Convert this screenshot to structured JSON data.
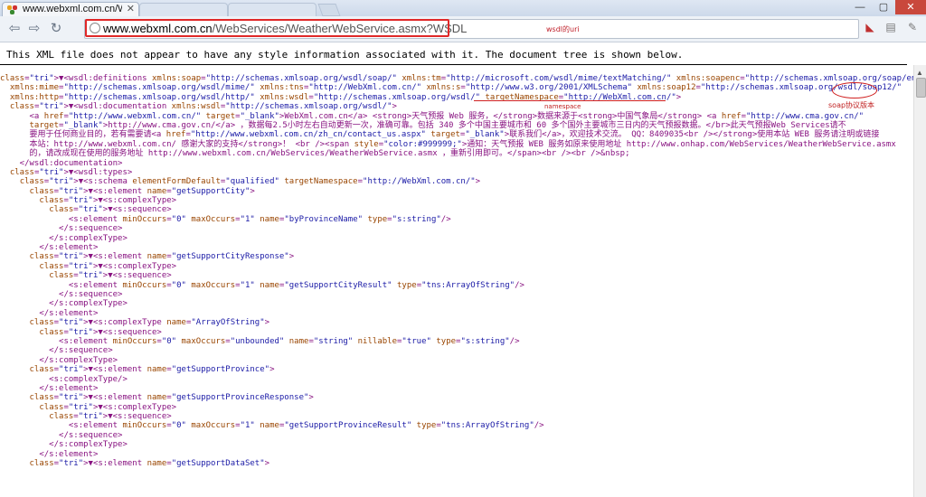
{
  "browser": {
    "tab_title": "www.webxml.com.cn/We",
    "url_host": "www.webxml.com.cn",
    "url_path": "/WebServices/WeatherWebService.asmx?WSDL"
  },
  "annotations": {
    "wsdl_uri": "wsdl的uri",
    "namespace": "namespace",
    "soap_version": "soap协议版本"
  },
  "info_message": "This XML file does not appear to have any style information associated with it. The document tree is shown below.",
  "xml_lines": [
    "▼<wsdl:definitions xmlns:soap=\"http://schemas.xmlsoap.org/wsdl/soap/\" xmlns:tm=\"http://microsoft.com/wsdl/mime/textMatching/\" xmlns:soapenc=\"http://schemas.xmlsoap.org/soap/encoding/\"",
    "  xmlns:mime=\"http://schemas.xmlsoap.org/wsdl/mime/\" xmlns:tns=\"http://WebXml.com.cn/\" xmlns:s=\"http://www.w3.org/2001/XMLSchema\" xmlns:soap12=\"http://schemas.xmlsoap.org/wsdl/soap12/\"",
    "  xmlns:http=\"http://schemas.xmlsoap.org/wsdl/http/\" xmlns:wsdl=\"http://schemas.xmlsoap.org/wsdl/\" targetNamespace=\"http://WebXml.com.cn/\">",
    "  ▼<wsdl:documentation xmlns:wsdl=\"http://schemas.xmlsoap.org/wsdl/\">",
    "      <a href=\"http://www.webxml.com.cn/\" target=\"_blank\">WebXml.com.cn</a> <strong>天气预报 Web 服务，</strong>数据来源于<strong>中国气象局</strong> <a href=\"http://www.cma.gov.cn/\"",
    "      target=\"_blank\">http://www.cma.gov.cn/</a> ，数据每2.5小时左右自动更新一次，准确可靠。包括 340 多个中国主要城市和 60 多个国外主要城市三日内的天气预报数据。</br>此天气预报Web Services请不",
    "      要用于任何商业目的，若有需要请<a href=\"http://www.webxml.com.cn/zh_cn/contact_us.aspx\" target=\"_blank\">联系我们</a>，欢迎技术交流。 QQ：8409035<br /></strong>使用本站 WEB 服务请注明或链接",
    "      本站：http://www.webxml.com.cn/ 感谢大家的支持</strong>！ <br /><span style=\"color:#999999;\">通知：天气预报 WEB 服务如原来使用地址 http://www.onhap.com/WebServices/WeatherWebService.asmx",
    "      的，请改成现在使用的服务地址 http://www.webxml.com.cn/WebServices/WeatherWebService.asmx ，重新引用即可。</span><br /><br />&nbsp;",
    "    </wsdl:documentation>",
    "  ▼<wsdl:types>",
    "    ▼<s:schema elementFormDefault=\"qualified\" targetNamespace=\"http://WebXml.com.cn/\">",
    "      ▼<s:element name=\"getSupportCity\">",
    "        ▼<s:complexType>",
    "          ▼<s:sequence>",
    "              <s:element minOccurs=\"0\" maxOccurs=\"1\" name=\"byProvinceName\" type=\"s:string\"/>",
    "            </s:sequence>",
    "          </s:complexType>",
    "        </s:element>",
    "      ▼<s:element name=\"getSupportCityResponse\">",
    "        ▼<s:complexType>",
    "          ▼<s:sequence>",
    "              <s:element minOccurs=\"0\" maxOccurs=\"1\" name=\"getSupportCityResult\" type=\"tns:ArrayOfString\"/>",
    "            </s:sequence>",
    "          </s:complexType>",
    "        </s:element>",
    "      ▼<s:complexType name=\"ArrayOfString\">",
    "        ▼<s:sequence>",
    "            <s:element minOccurs=\"0\" maxOccurs=\"unbounded\" name=\"string\" nillable=\"true\" type=\"s:string\"/>",
    "          </s:sequence>",
    "        </s:complexType>",
    "      ▼<s:element name=\"getSupportProvince\">",
    "          <s:complexType/>",
    "        </s:element>",
    "      ▼<s:element name=\"getSupportProvinceResponse\">",
    "        ▼<s:complexType>",
    "          ▼<s:sequence>",
    "              <s:element minOccurs=\"0\" maxOccurs=\"1\" name=\"getSupportProvinceResult\" type=\"tns:ArrayOfString\"/>",
    "            </s:sequence>",
    "          </s:complexType>",
    "        </s:element>",
    "      ▼<s:element name=\"getSupportDataSet\">"
  ]
}
